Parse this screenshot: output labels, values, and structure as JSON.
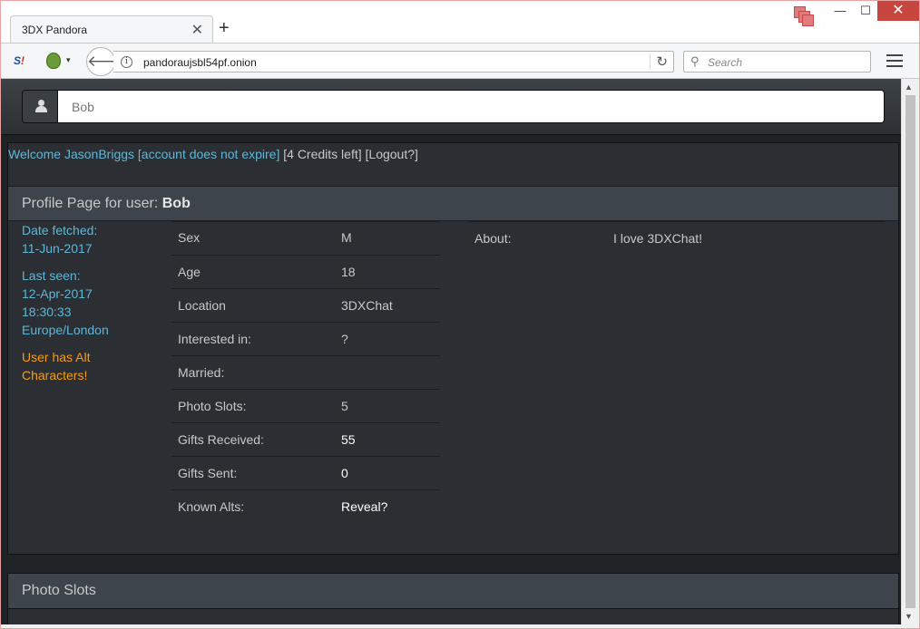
{
  "browser": {
    "tab_title": "3DX Pandora",
    "tab_close": "✕",
    "new_tab": "+",
    "url": "pandoraujsbl54pf.onion",
    "search_placeholder": "Search",
    "window_min": "—",
    "window_max": "☐",
    "window_close": "✕",
    "back_glyph": "🡐",
    "reload_glyph": "↻",
    "search_glyph": "⚲",
    "si_logo": "S",
    "si_logo_accent": "!",
    "onion_caret": "▾",
    "info_glyph": "i",
    "scroll_up": "▲",
    "scroll_down": "▼"
  },
  "header": {
    "search_value": "Bob"
  },
  "welcome": {
    "text": "Welcome JasonBriggs [account does not expire]",
    "credits": "[4 Credits left]",
    "logout": "[Logout?]"
  },
  "profile": {
    "heading_prefix": "Profile Page for user:",
    "username": "Bob",
    "date_fetched_label": "Date fetched:",
    "date_fetched": "11-Jun-2017",
    "last_seen_label": "Last seen:",
    "last_seen_date": "12-Apr-2017",
    "last_seen_time": "18:30:33",
    "last_seen_tz": "Europe/London",
    "alt_warning": "User has Alt Characters!",
    "fields": [
      {
        "label": "Sex",
        "value": "M"
      },
      {
        "label": "Age",
        "value": "18"
      },
      {
        "label": "Location",
        "value": "3DXChat"
      },
      {
        "label": "Interested in:",
        "value": "?"
      },
      {
        "label": "Married:",
        "value": ""
      },
      {
        "label": "Photo Slots:",
        "value": "5"
      },
      {
        "label": "Gifts Received:",
        "value": "55"
      },
      {
        "label": "Gifts Sent:",
        "value": "0"
      },
      {
        "label": "Known Alts:",
        "value": "Reveal?"
      }
    ],
    "about_label": "About:",
    "about_value": "I love 3DXChat!"
  },
  "photo_slots": {
    "title": "Photo Slots"
  }
}
